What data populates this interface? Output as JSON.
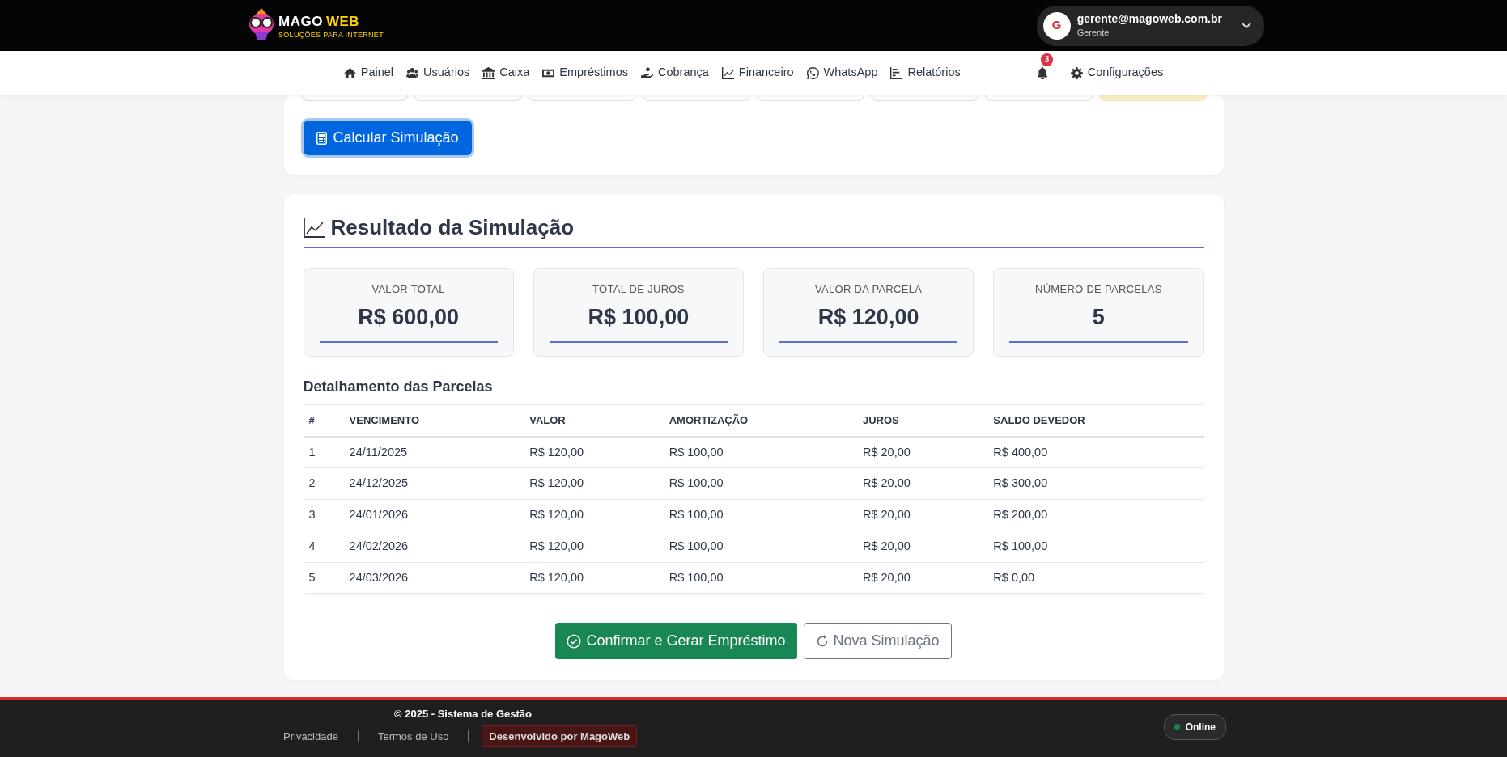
{
  "brand": {
    "word_1": "MAGO",
    "word_2": "WEB",
    "tagline": "SOLUÇÕES PARA INTERNET"
  },
  "user": {
    "initial": "G",
    "email": "gerente@magoweb.com.br",
    "role": "Gerente"
  },
  "nav": [
    {
      "label": "Painel"
    },
    {
      "label": "Usuários"
    },
    {
      "label": "Caixa"
    },
    {
      "label": "Empréstimos"
    },
    {
      "label": "Cobrança"
    },
    {
      "label": "Financeiro"
    },
    {
      "label": "WhatsApp"
    },
    {
      "label": "Relatórios"
    }
  ],
  "notifications": {
    "count": "3"
  },
  "settings": {
    "label": "Configurações"
  },
  "option_tiles": [
    {
      "highlighted": false
    },
    {
      "highlighted": false
    },
    {
      "highlighted": false
    },
    {
      "highlighted": false
    },
    {
      "highlighted": false
    },
    {
      "highlighted": false
    },
    {
      "highlighted": false
    },
    {
      "highlighted": true
    }
  ],
  "calculate_button": "Calcular Simulação",
  "result": {
    "title": "Resultado da Simulação",
    "stats": [
      {
        "label": "VALOR TOTAL",
        "value": "R$ 600,00"
      },
      {
        "label": "TOTAL DE JUROS",
        "value": "R$ 100,00"
      },
      {
        "label": "VALOR DA PARCELA",
        "value": "R$ 120,00"
      },
      {
        "label": "NÚMERO DE PARCELAS",
        "value": "5"
      }
    ],
    "table_title": "Detalhamento das Parcelas",
    "table": {
      "columns": [
        "#",
        "VENCIMENTO",
        "VALOR",
        "AMORTIZAÇÃO",
        "JUROS",
        "SALDO DEVEDOR"
      ],
      "rows": [
        [
          "1",
          "24/11/2025",
          "R$ 120,00",
          "R$ 100,00",
          "R$ 20,00",
          "R$ 400,00"
        ],
        [
          "2",
          "24/12/2025",
          "R$ 120,00",
          "R$ 100,00",
          "R$ 20,00",
          "R$ 300,00"
        ],
        [
          "3",
          "24/01/2026",
          "R$ 120,00",
          "R$ 100,00",
          "R$ 20,00",
          "R$ 200,00"
        ],
        [
          "4",
          "24/02/2026",
          "R$ 120,00",
          "R$ 100,00",
          "R$ 20,00",
          "R$ 100,00"
        ],
        [
          "5",
          "24/03/2026",
          "R$ 120,00",
          "R$ 100,00",
          "R$ 20,00",
          "R$ 0,00"
        ]
      ]
    },
    "confirm_button": "Confirmar e Gerar Empréstimo",
    "new_button": "Nova Simulação"
  },
  "footer": {
    "copyright": "© 2025 - Sistema de Gestão",
    "links": [
      {
        "label": "Privacidade",
        "highlighted": false
      },
      {
        "label": "Termos de Uso",
        "highlighted": false
      },
      {
        "label": "Desenvolvido por MagoWeb",
        "highlighted": true
      }
    ],
    "status": {
      "label": "Online",
      "color": "#198754"
    }
  }
}
